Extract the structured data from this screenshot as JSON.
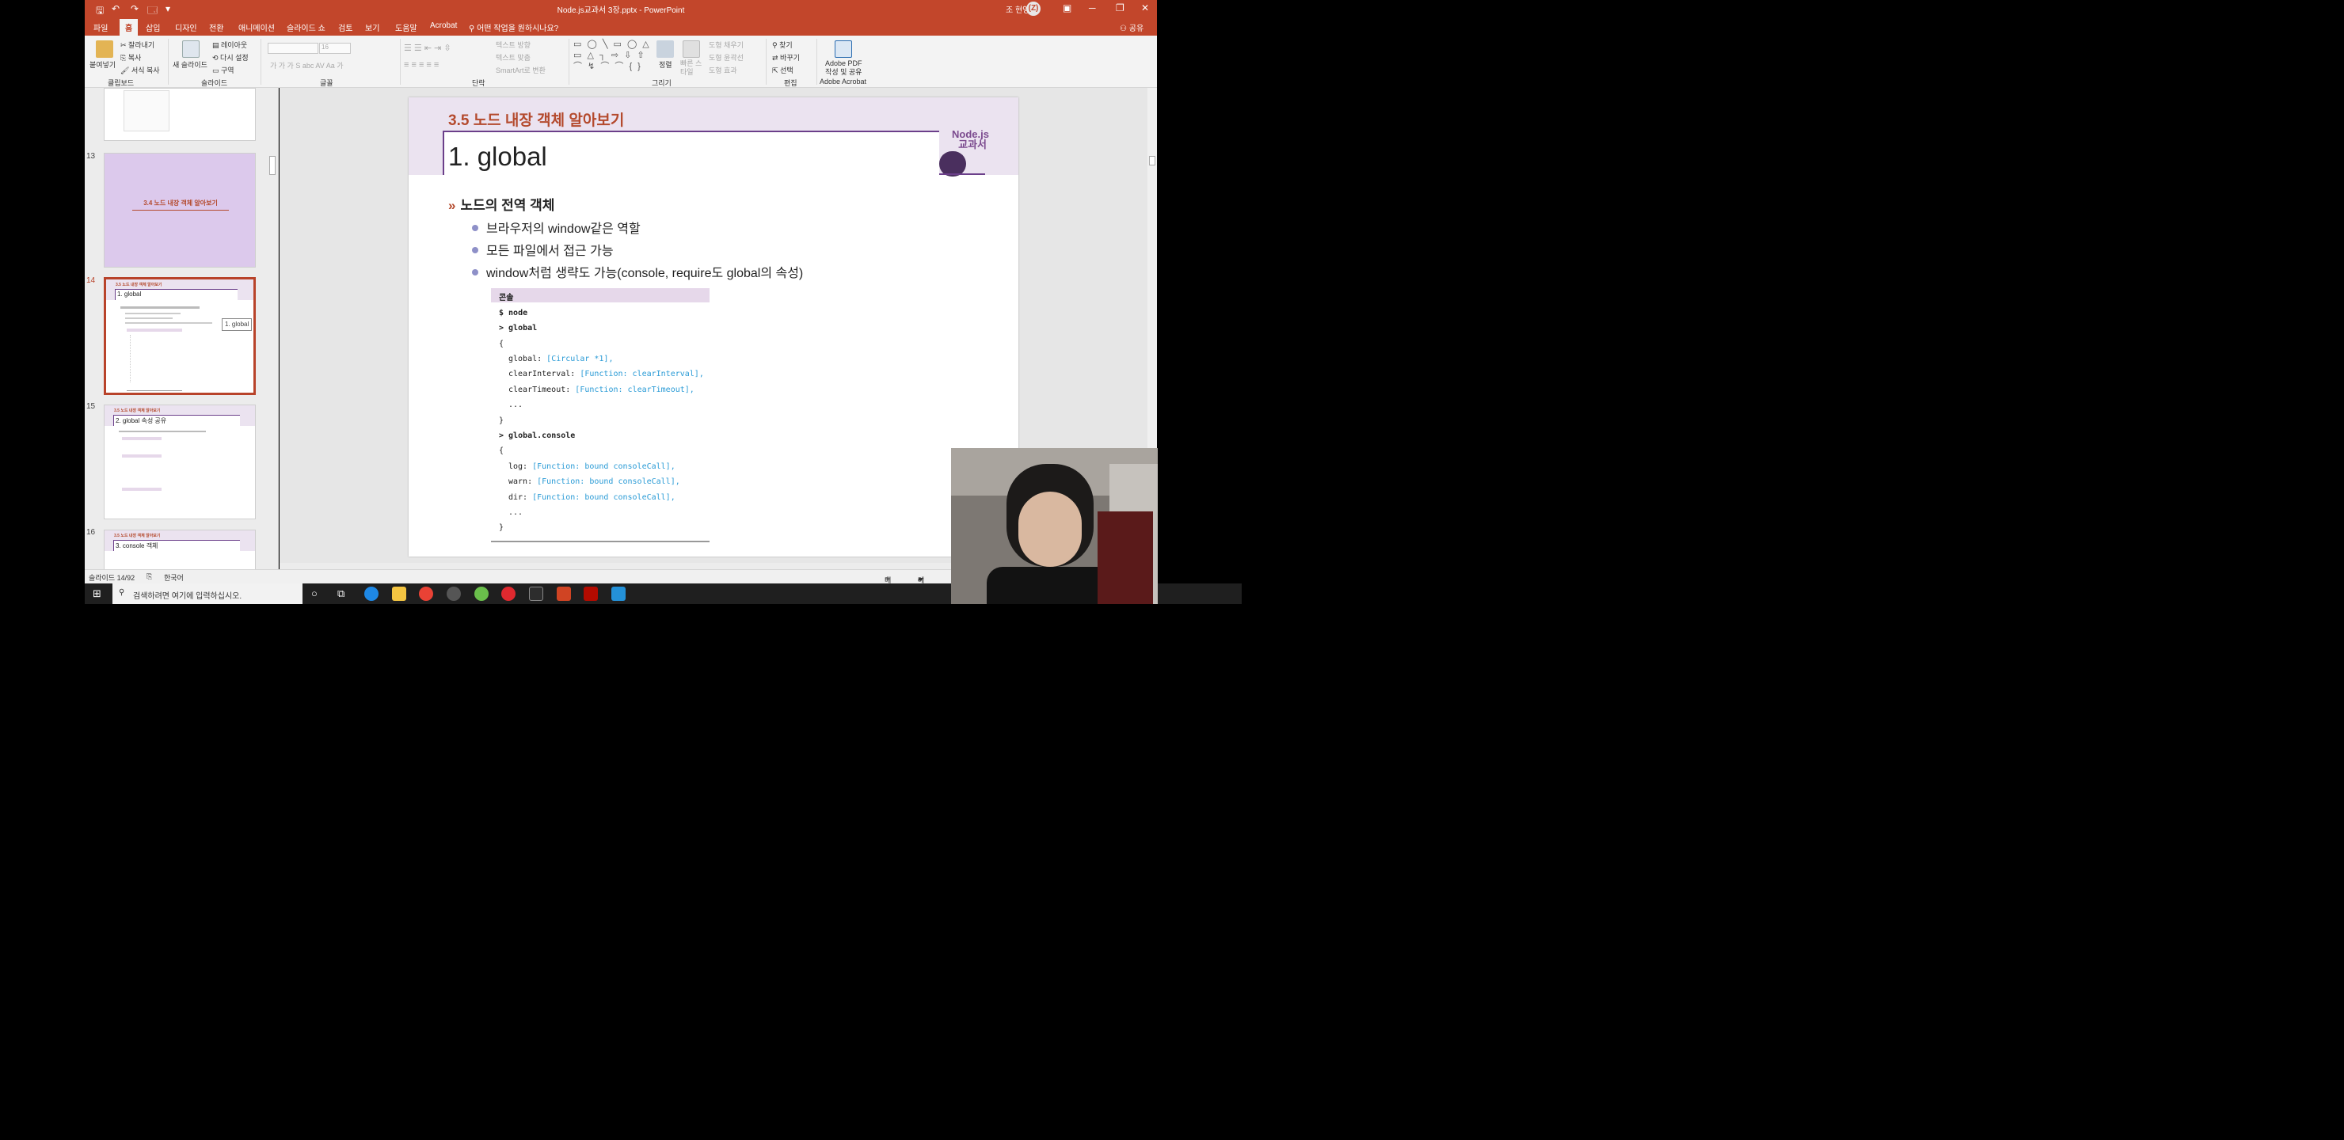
{
  "titlebar": {
    "save": "🖫",
    "undo": "↶",
    "redo": "↷",
    "repeat": "⟳",
    "slideshow": "🗔",
    "customize": "▾",
    "doc_title": "Node.js교과서 3장.pptx  -  PowerPoint",
    "user_name": "조 현영",
    "avatar": "(Z)",
    "display_options": "▣",
    "minimize": "─",
    "restore": "❐",
    "close": "✕"
  },
  "tabs": [
    "파일",
    "홈",
    "삽입",
    "디자인",
    "전환",
    "애니메이션",
    "슬라이드 쇼",
    "검토",
    "보기",
    "도움말",
    "Acrobat"
  ],
  "tell_me": "어떤 작업을 원하시나요?",
  "share": "공유",
  "ribbon": {
    "groups": [
      "클립보드",
      "슬라이드",
      "글꼴",
      "단락",
      "그리기",
      "편집",
      "Adobe Acrobat"
    ],
    "clipboard": {
      "paste": "붙여넣기",
      "cut": "잘라내기",
      "copy": "복사",
      "format_painter": "서식 복사"
    },
    "slides": {
      "new_slide": "새 슬라이드",
      "layout": "레이아웃",
      "reset": "다시 설정",
      "section": "구역"
    },
    "font": {
      "size": "16",
      "row": "가  가  가  S  abc  AV  Aa  가"
    },
    "paragraph": {
      "direction": "텍스트 방향",
      "align": "텍스트 맞춤",
      "smartart": "SmartArt로 변환"
    },
    "drawing": {
      "arrange": "정렬",
      "quick_styles": "빠른 스타일",
      "fill": "도형 채우기",
      "outline": "도형 윤곽선",
      "effects": "도형 효과",
      "shapes": "▭ ◯ ╲ ▭ ◯ △\n▭ △ ┐ ⇨ ⇩ ⇧\n⌒ ↯ ⌒ ⌒ { }"
    },
    "editing": {
      "find": "찾기",
      "replace": "바꾸기",
      "select": "선택"
    },
    "acrobat": {
      "create_pdf": "Adobe PDF",
      "create_share": "작성 및 공유"
    }
  },
  "thumbnails": [
    {
      "num": "13",
      "title": "3.4 노드 내장 객체 알아보기"
    },
    {
      "num": "14",
      "sub": "3.5 노드 내장 객체 알아보기",
      "title": "1. global"
    },
    {
      "num": "15",
      "sub": "3.5 노드 내장 객체 알아보기",
      "title": "2. global 속성 공유"
    },
    {
      "num": "16",
      "sub": "3.5 노드 내장 객체 알아보기",
      "title": "3. console 객체"
    }
  ],
  "tooltip": "1. global",
  "slide": {
    "section": "3.5 노드 내장 객체 알아보기",
    "title": "1. global",
    "logo": "Node.js\n교과서",
    "heading": "노드의 전역 객체",
    "bullets": [
      "브라우저의 window같은 역할",
      "모든 파일에서 접근 가능",
      "window처럼 생략도 가능(console, require도 global의 속성)"
    ],
    "console_label": "콘솔",
    "console": {
      "l1": "$ node",
      "l2": "> global",
      "l3": "{",
      "l4k": "global: ",
      "l4v": "[Circular *1],",
      "l5k": "clearInterval: ",
      "l5v": "[Function: clearInterval],",
      "l6k": "clearTimeout: ",
      "l6v": "[Function: clearTimeout],",
      "l7": "...",
      "l8": "}",
      "l9": "> global.console",
      "l10": "{",
      "l11k": "log: ",
      "l11v": "[Function: bound consoleCall],",
      "l12k": "warn: ",
      "l12v": "[Function: bound consoleCall],",
      "l13k": "dir: ",
      "l13v": "[Function: bound consoleCall],",
      "l14": "...",
      "l15": "}"
    }
  },
  "status": {
    "slide_no": "슬라이드 14/92",
    "language": "한국어",
    "notes": "메모",
    "comments": "메모"
  },
  "taskbar": {
    "search_placeholder": "검색하려면 여기에 입력하십시오."
  }
}
